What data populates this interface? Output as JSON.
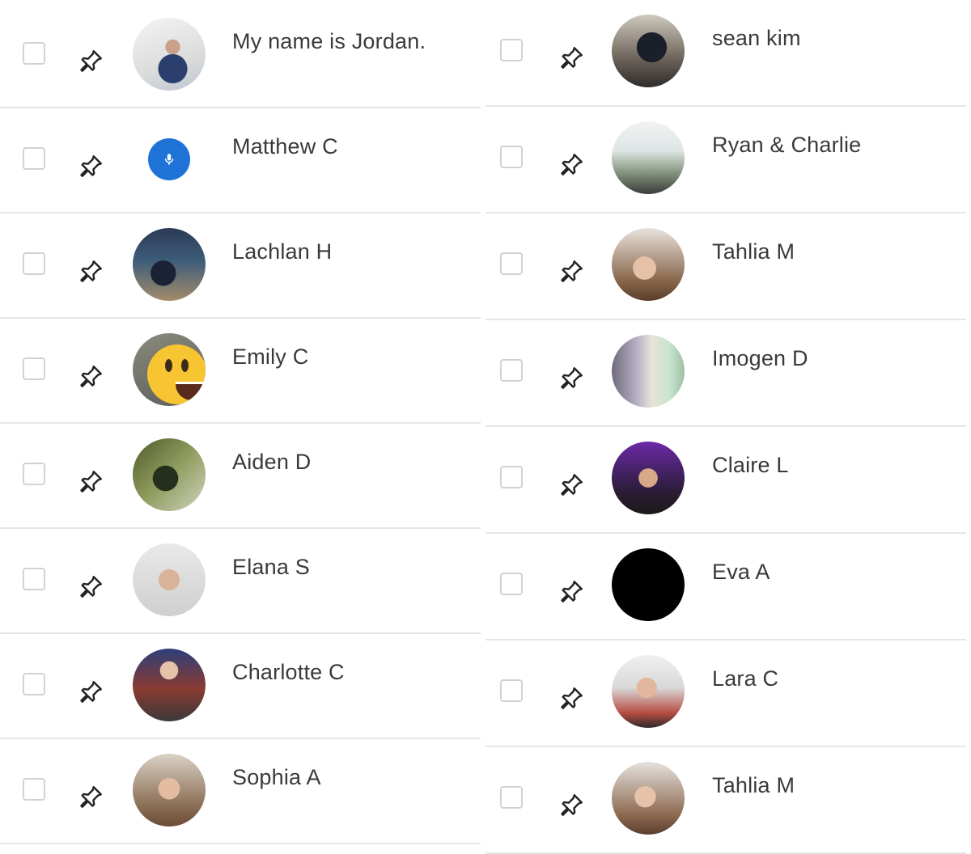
{
  "participants": {
    "left": [
      {
        "name": "My name is Jordan.",
        "avatar": "photo"
      },
      {
        "name": "Matthew C",
        "avatar": "mic-icon"
      },
      {
        "name": "Lachlan H",
        "avatar": "photo"
      },
      {
        "name": "Emily C",
        "avatar": "emoji-grinning"
      },
      {
        "name": "Aiden D",
        "avatar": "photo"
      },
      {
        "name": "Elana S",
        "avatar": "photo"
      },
      {
        "name": "Charlotte C",
        "avatar": "photo"
      },
      {
        "name": "Sophia A",
        "avatar": "photo"
      }
    ],
    "right": [
      {
        "name": "sean kim",
        "avatar": "photo"
      },
      {
        "name": "Ryan & Charlie",
        "avatar": "photo"
      },
      {
        "name": "Tahlia M",
        "avatar": "photo"
      },
      {
        "name": "Imogen D",
        "avatar": "photo"
      },
      {
        "name": "Claire L",
        "avatar": "photo"
      },
      {
        "name": "Eva A",
        "avatar": "blank-black"
      },
      {
        "name": "Lara C",
        "avatar": "photo"
      },
      {
        "name": "Tahlia M",
        "avatar": "photo"
      }
    ]
  },
  "colors": {
    "text": "#3a3a3a",
    "divider": "#e6e6e6",
    "checkbox_border": "#d2d2d2",
    "mic_accent": "#1f73d6"
  },
  "icons": {
    "checkbox": "checkbox-icon",
    "pin": "pushpin-icon",
    "mic": "microphone-icon"
  }
}
